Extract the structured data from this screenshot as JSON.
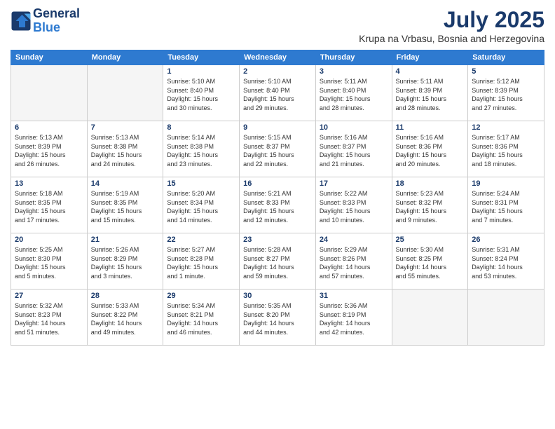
{
  "header": {
    "logo": {
      "line1": "General",
      "line2": "Blue"
    },
    "title": "July 2025",
    "location": "Krupa na Vrbasu, Bosnia and Herzegovina"
  },
  "weekdays": [
    "Sunday",
    "Monday",
    "Tuesday",
    "Wednesday",
    "Thursday",
    "Friday",
    "Saturday"
  ],
  "weeks": [
    [
      {
        "day": null,
        "info": ""
      },
      {
        "day": null,
        "info": ""
      },
      {
        "day": "1",
        "info": "Sunrise: 5:10 AM\nSunset: 8:40 PM\nDaylight: 15 hours\nand 30 minutes."
      },
      {
        "day": "2",
        "info": "Sunrise: 5:10 AM\nSunset: 8:40 PM\nDaylight: 15 hours\nand 29 minutes."
      },
      {
        "day": "3",
        "info": "Sunrise: 5:11 AM\nSunset: 8:40 PM\nDaylight: 15 hours\nand 28 minutes."
      },
      {
        "day": "4",
        "info": "Sunrise: 5:11 AM\nSunset: 8:39 PM\nDaylight: 15 hours\nand 28 minutes."
      },
      {
        "day": "5",
        "info": "Sunrise: 5:12 AM\nSunset: 8:39 PM\nDaylight: 15 hours\nand 27 minutes."
      }
    ],
    [
      {
        "day": "6",
        "info": "Sunrise: 5:13 AM\nSunset: 8:39 PM\nDaylight: 15 hours\nand 26 minutes."
      },
      {
        "day": "7",
        "info": "Sunrise: 5:13 AM\nSunset: 8:38 PM\nDaylight: 15 hours\nand 24 minutes."
      },
      {
        "day": "8",
        "info": "Sunrise: 5:14 AM\nSunset: 8:38 PM\nDaylight: 15 hours\nand 23 minutes."
      },
      {
        "day": "9",
        "info": "Sunrise: 5:15 AM\nSunset: 8:37 PM\nDaylight: 15 hours\nand 22 minutes."
      },
      {
        "day": "10",
        "info": "Sunrise: 5:16 AM\nSunset: 8:37 PM\nDaylight: 15 hours\nand 21 minutes."
      },
      {
        "day": "11",
        "info": "Sunrise: 5:16 AM\nSunset: 8:36 PM\nDaylight: 15 hours\nand 20 minutes."
      },
      {
        "day": "12",
        "info": "Sunrise: 5:17 AM\nSunset: 8:36 PM\nDaylight: 15 hours\nand 18 minutes."
      }
    ],
    [
      {
        "day": "13",
        "info": "Sunrise: 5:18 AM\nSunset: 8:35 PM\nDaylight: 15 hours\nand 17 minutes."
      },
      {
        "day": "14",
        "info": "Sunrise: 5:19 AM\nSunset: 8:35 PM\nDaylight: 15 hours\nand 15 minutes."
      },
      {
        "day": "15",
        "info": "Sunrise: 5:20 AM\nSunset: 8:34 PM\nDaylight: 15 hours\nand 14 minutes."
      },
      {
        "day": "16",
        "info": "Sunrise: 5:21 AM\nSunset: 8:33 PM\nDaylight: 15 hours\nand 12 minutes."
      },
      {
        "day": "17",
        "info": "Sunrise: 5:22 AM\nSunset: 8:33 PM\nDaylight: 15 hours\nand 10 minutes."
      },
      {
        "day": "18",
        "info": "Sunrise: 5:23 AM\nSunset: 8:32 PM\nDaylight: 15 hours\nand 9 minutes."
      },
      {
        "day": "19",
        "info": "Sunrise: 5:24 AM\nSunset: 8:31 PM\nDaylight: 15 hours\nand 7 minutes."
      }
    ],
    [
      {
        "day": "20",
        "info": "Sunrise: 5:25 AM\nSunset: 8:30 PM\nDaylight: 15 hours\nand 5 minutes."
      },
      {
        "day": "21",
        "info": "Sunrise: 5:26 AM\nSunset: 8:29 PM\nDaylight: 15 hours\nand 3 minutes."
      },
      {
        "day": "22",
        "info": "Sunrise: 5:27 AM\nSunset: 8:28 PM\nDaylight: 15 hours\nand 1 minute."
      },
      {
        "day": "23",
        "info": "Sunrise: 5:28 AM\nSunset: 8:27 PM\nDaylight: 14 hours\nand 59 minutes."
      },
      {
        "day": "24",
        "info": "Sunrise: 5:29 AM\nSunset: 8:26 PM\nDaylight: 14 hours\nand 57 minutes."
      },
      {
        "day": "25",
        "info": "Sunrise: 5:30 AM\nSunset: 8:25 PM\nDaylight: 14 hours\nand 55 minutes."
      },
      {
        "day": "26",
        "info": "Sunrise: 5:31 AM\nSunset: 8:24 PM\nDaylight: 14 hours\nand 53 minutes."
      }
    ],
    [
      {
        "day": "27",
        "info": "Sunrise: 5:32 AM\nSunset: 8:23 PM\nDaylight: 14 hours\nand 51 minutes."
      },
      {
        "day": "28",
        "info": "Sunrise: 5:33 AM\nSunset: 8:22 PM\nDaylight: 14 hours\nand 49 minutes."
      },
      {
        "day": "29",
        "info": "Sunrise: 5:34 AM\nSunset: 8:21 PM\nDaylight: 14 hours\nand 46 minutes."
      },
      {
        "day": "30",
        "info": "Sunrise: 5:35 AM\nSunset: 8:20 PM\nDaylight: 14 hours\nand 44 minutes."
      },
      {
        "day": "31",
        "info": "Sunrise: 5:36 AM\nSunset: 8:19 PM\nDaylight: 14 hours\nand 42 minutes."
      },
      {
        "day": null,
        "info": ""
      },
      {
        "day": null,
        "info": ""
      }
    ]
  ]
}
